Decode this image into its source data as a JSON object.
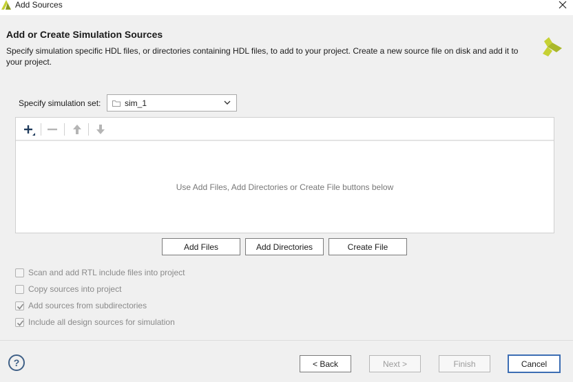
{
  "window": {
    "title": "Add Sources"
  },
  "header": {
    "heading": "Add or Create Simulation Sources",
    "description": "Specify simulation specific HDL files, or directories containing HDL files, to add to your project. Create a new source file on disk and add it to your project."
  },
  "simulation_set": {
    "label": "Specify simulation set:",
    "value": "sim_1"
  },
  "files_panel": {
    "empty_message": "Use Add Files, Add Directories or Create File buttons below"
  },
  "buttons": {
    "add_files": "Add Files",
    "add_directories": "Add Directories",
    "create_file": "Create File"
  },
  "options": [
    {
      "label": "Scan and add RTL include files into project",
      "checked": false
    },
    {
      "label": "Copy sources into project",
      "checked": false
    },
    {
      "label": "Add sources from subdirectories",
      "checked": true
    },
    {
      "label": "Include all design sources for simulation",
      "checked": true
    }
  ],
  "footer": {
    "help": "?",
    "back": "< Back",
    "next": "Next >",
    "finish": "Finish",
    "cancel": "Cancel"
  },
  "colors": {
    "accent": "#3b6db3",
    "logo_green": "#c6d134",
    "disabled_text": "#8a8a8a"
  }
}
